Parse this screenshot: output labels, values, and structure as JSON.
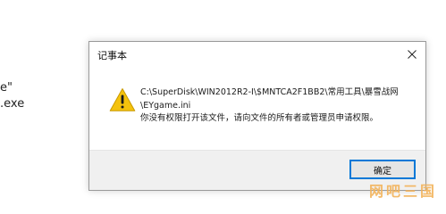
{
  "background": {
    "lines": [
      "e\"",
      ".exe"
    ]
  },
  "dialog": {
    "title": "记事本",
    "close_icon": "close-icon",
    "warning_icon": "warning-icon",
    "message_lines": [
      "C:\\SuperDisk\\WIN2012R2-I\\$MNTCA2F1BB2\\常用工具\\暴雪战网",
      "\\EYgame.ini",
      "你没有权限打开该文件，请向文件的所有者或管理员申请权限。"
    ],
    "ok_label": "确定"
  },
  "watermark": {
    "text": "网吧三国"
  },
  "colors": {
    "accent_border": "#0078d7",
    "footer_bg": "#f0f0f0",
    "warning_yellow": "#f4c20d",
    "watermark": "#f3b35a"
  }
}
